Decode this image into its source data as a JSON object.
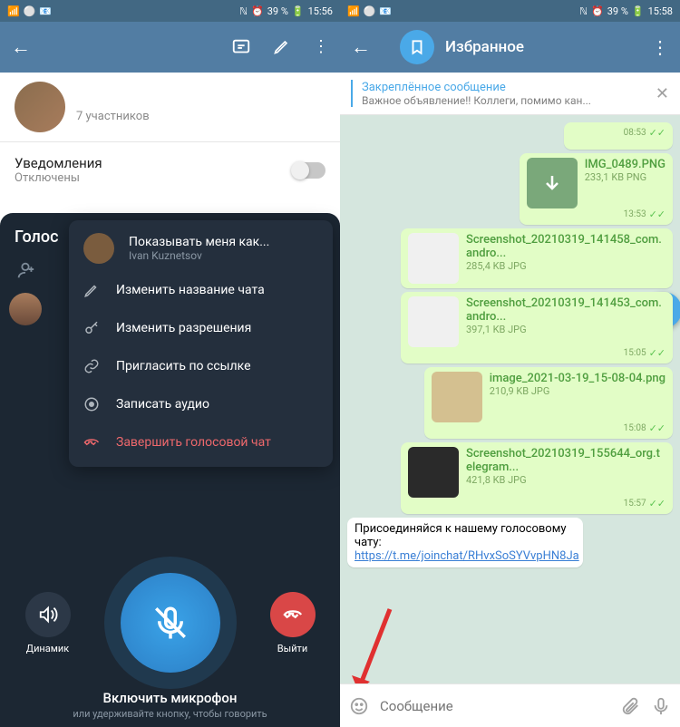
{
  "left": {
    "status": {
      "battery": "39 %",
      "time": "15:56"
    },
    "header": {
      "members": "7 участников"
    },
    "notif": {
      "title": "Уведомления",
      "sub": "Отключены"
    },
    "voice_title": "Голос",
    "menu": {
      "show_as": "Показывать меня как...",
      "show_as_name": "Ivan Kuznetsov",
      "rename": "Изменить название чата",
      "permissions": "Изменить разрешения",
      "invite": "Пригласить по ссылке",
      "record": "Записать аудио",
      "end": "Завершить голосовой чат"
    },
    "controls": {
      "speaker": "Динамик",
      "exit": "Выйти"
    },
    "caption": {
      "line1": "Включить микрофон",
      "line2": "или удерживайте кнопку, чтобы говорить"
    }
  },
  "right": {
    "status": {
      "battery": "39 %",
      "time": "15:58"
    },
    "title": "Избранное",
    "pinned": {
      "title": "Закреплённое сообщение",
      "text": "Важное объявление!! Коллеги, помимо кан..."
    },
    "msgs": [
      {
        "time": "08:53"
      },
      {
        "fn": "IMG_0489.PNG",
        "fs": "233,1 KB PNG",
        "time": "13:53"
      },
      {
        "fn": "Screenshot_20210319_141458_com.andro...",
        "fs": "285,4 KB JPG",
        "time": ""
      },
      {
        "fn": "Screenshot_20210319_141453_com.andro...",
        "fs": "397,1 KB JPG",
        "time": "15:05"
      },
      {
        "fn": "image_2021-03-19_15-08-04.png",
        "fs": "210,9 KB JPG",
        "time": "15:08"
      },
      {
        "fn": "Screenshot_20210319_155644_org.telegram...",
        "fs": "421,8 KB JPG",
        "time": "15:57"
      }
    ],
    "textmsg": {
      "pre": "Присоединяйся к нашему голосовому чату: ",
      "link": "https://t.me/joinchat/RHvxSoSYVvpHN8Ja"
    },
    "input_placeholder": "Сообщение"
  }
}
